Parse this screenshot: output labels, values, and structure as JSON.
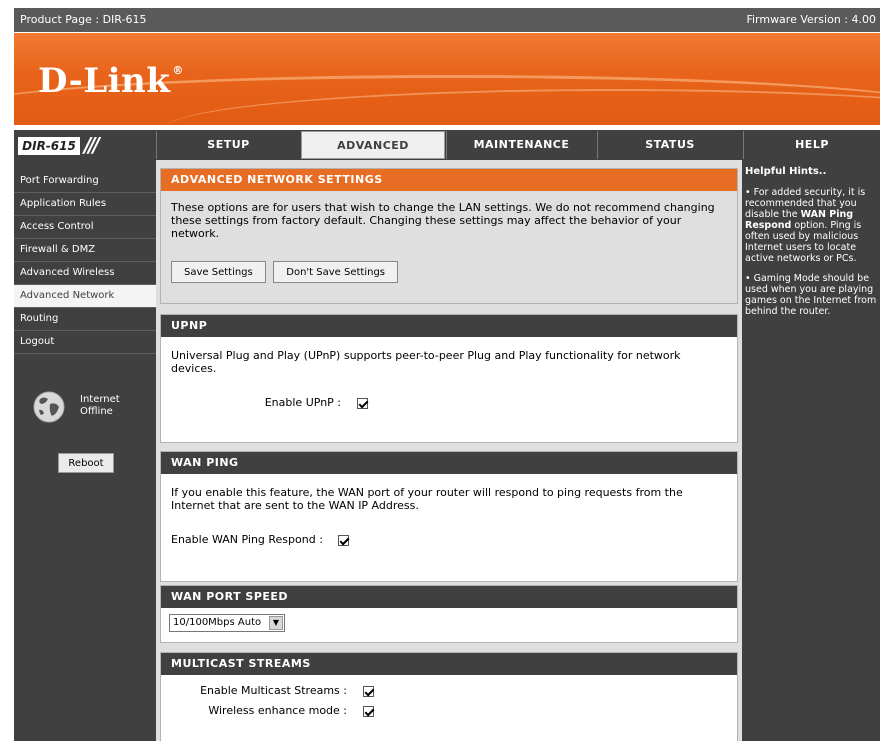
{
  "topbar": {
    "product": "Product Page : DIR-615",
    "firmware": "Firmware Version : 4.00"
  },
  "header": {
    "logo": "D-Link",
    "registered_mark": "®"
  },
  "model": {
    "name": "DIR-615",
    "slashes": "///"
  },
  "nav": {
    "tabs": [
      {
        "label": "SETUP",
        "active": false
      },
      {
        "label": "ADVANCED",
        "active": true
      },
      {
        "label": "MAINTENANCE",
        "active": false
      },
      {
        "label": "STATUS",
        "active": false
      },
      {
        "label": "HELP",
        "active": false
      }
    ]
  },
  "sidebar": {
    "items": [
      {
        "label": "Port Forwarding"
      },
      {
        "label": "Application Rules"
      },
      {
        "label": "Access Control"
      },
      {
        "label": "Firewall & DMZ"
      },
      {
        "label": "Advanced Wireless"
      },
      {
        "label": "Advanced Network",
        "active": true
      },
      {
        "label": "Routing"
      },
      {
        "label": "Logout"
      }
    ],
    "status_line1": "Internet",
    "status_line2": "Offline",
    "reboot_label": "Reboot",
    "globe_icon": "globe-icon"
  },
  "advanced": {
    "title": "ADVANCED NETWORK SETTINGS",
    "description": "These options are for users that wish to change the LAN settings. We do not recommend changing these settings from factory default. Changing these settings may affect the behavior of your network.",
    "save_label": "Save Settings",
    "dont_save_label": "Don't Save Settings"
  },
  "upnp": {
    "title": "UPNP",
    "description": "Universal Plug and Play (UPnP) supports peer-to-peer Plug and Play functionality for network devices.",
    "enable_label": "Enable UPnP :",
    "enabled": true
  },
  "wan_ping": {
    "title": "WAN PING",
    "description": "If you enable this feature, the WAN port of your router will respond to ping requests from the Internet that are sent to the WAN IP Address.",
    "enable_label": "Enable WAN Ping Respond :",
    "enabled": true
  },
  "wan_port_speed": {
    "title": "WAN PORT SPEED",
    "selected": "10/100Mbps Auto",
    "arrow": "▼"
  },
  "multicast": {
    "title": "MULTICAST STREAMS",
    "enable_label": "Enable Multicast Streams :",
    "enabled": true,
    "wireless_label": "Wireless enhance mode :",
    "wireless_enabled": true
  },
  "help": {
    "title": "Helpful Hints..",
    "hint1_before": "• For added security, it is recommended that you disable the ",
    "hint1_bold": "WAN Ping Respond",
    "hint1_after": " option. Ping is often used by malicious Internet users to locate active networks or PCs.",
    "hint2": "• Gaming Mode should be used when you are playing games on the Internet from behind the router."
  },
  "colors": {
    "accent_orange": "#e86d24",
    "dark_gray": "#404040",
    "panel_gray": "#dfdfdf"
  }
}
